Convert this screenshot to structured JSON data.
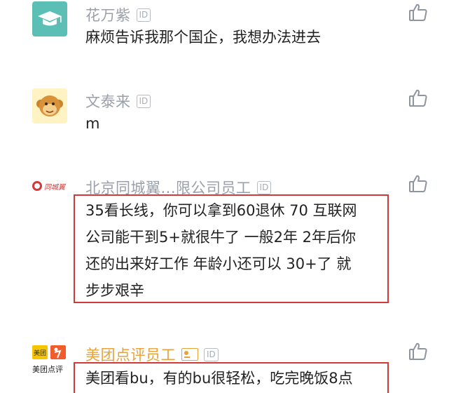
{
  "comments": [
    {
      "name": "花万紫",
      "id_badge": "ID",
      "text": "麻烦告诉我那个国企，我想办法进去"
    },
    {
      "name": "文泰来",
      "id_badge": "ID",
      "text": "m"
    },
    {
      "name": "北京同城翼...限公司员工",
      "id_badge": "ID",
      "avatar_text": "同城翼",
      "lines": [
        "35看长线，你可以拿到60退休 70 互联网",
        "公司能干到5+就很牛了 一般2年 2年后你",
        "还的出来好工作 年龄小还可以 30+了 就",
        "步步艰辛"
      ]
    },
    {
      "name": "美团点评员工",
      "id_badge": "ID",
      "avatar_top_left": "美团",
      "avatar_caption": "美团点评",
      "text": "美团看bu，有的bu很轻松，吃完晚饭8点"
    }
  ],
  "colors": {
    "name_gray": "#9aa0aa",
    "name_orange": "#e8a23a",
    "highlight_red": "#d23a3a",
    "teal": "#5bbfb6"
  },
  "icons": {
    "like": "thumbs-up-icon",
    "graduation": "graduation-cap-icon",
    "monkey": "monkey-face-icon",
    "verified_card": "id-card-icon"
  }
}
